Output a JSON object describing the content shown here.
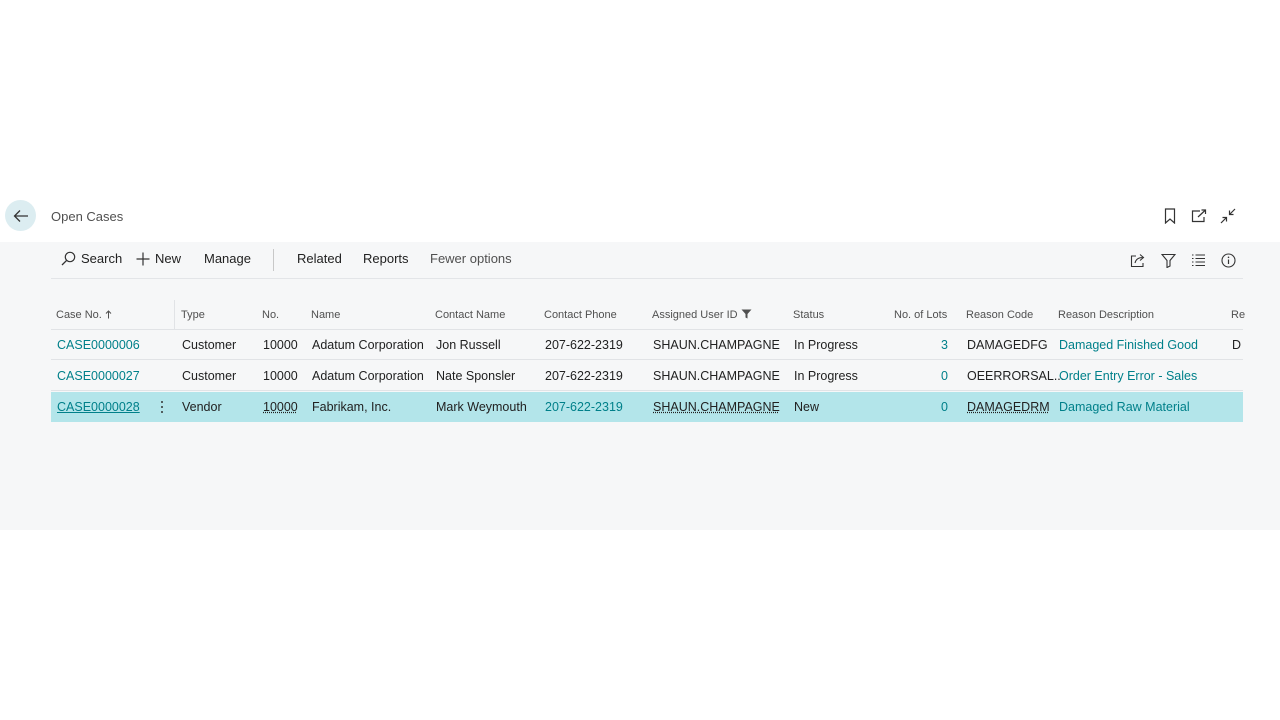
{
  "header": {
    "title": "Open Cases"
  },
  "actions": {
    "search": "Search",
    "new": "New",
    "manage": "Manage",
    "related": "Related",
    "reports": "Reports",
    "fewer": "Fewer options"
  },
  "columns": {
    "case_no": "Case No.",
    "type": "Type",
    "no": "No.",
    "name": "Name",
    "contact_name": "Contact Name",
    "contact_phone": "Contact Phone",
    "assigned_user": "Assigned User ID",
    "status": "Status",
    "lots": "No. of Lots",
    "reason_code": "Reason Code",
    "reason_desc": "Reason Description",
    "re": "Re"
  },
  "rows": [
    {
      "case_no": "CASE0000006",
      "type": "Customer",
      "no": "10000",
      "name": "Adatum Corporation",
      "contact_name": "Jon Russell",
      "contact_phone": "207-622-2319",
      "assigned_user": "SHAUN.CHAMPAGNE",
      "status": "In Progress",
      "lots": "3",
      "reason_code": "DAMAGEDFG",
      "reason_desc": "Damaged Finished Good",
      "re": "D"
    },
    {
      "case_no": "CASE0000027",
      "type": "Customer",
      "no": "10000",
      "name": "Adatum Corporation",
      "contact_name": "Nate Sponsler",
      "contact_phone": "207-622-2319",
      "assigned_user": "SHAUN.CHAMPAGNE",
      "status": "In Progress",
      "lots": "0",
      "reason_code": "OEERRORSAL...",
      "reason_desc": "Order Entry Error - Sales",
      "re": ""
    },
    {
      "case_no": "CASE0000028",
      "type": "Vendor",
      "no": "10000",
      "name": "Fabrikam, Inc.",
      "contact_name": "Mark Weymouth",
      "contact_phone": "207-622-2319",
      "assigned_user": "SHAUN.CHAMPAGNE",
      "status": "New",
      "lots": "0",
      "reason_code": "DAMAGEDRM",
      "reason_desc": "Damaged Raw Material",
      "re": ""
    }
  ],
  "colors": {
    "accent": "#00808a",
    "selected_row": "#b3e5ea",
    "content_bg": "#f6f7f8"
  },
  "icons": {
    "back": "arrow-left-icon",
    "bookmark": "bookmark-icon",
    "open_new_window": "open-in-new-window-icon",
    "collapse": "collapse-icon",
    "search": "search-icon",
    "new": "plus-icon",
    "share": "share-icon",
    "filter": "filter-icon",
    "list": "list-view-icon",
    "info": "info-icon",
    "sort_asc": "sort-ascending-icon",
    "column_filter": "column-filter-icon"
  }
}
